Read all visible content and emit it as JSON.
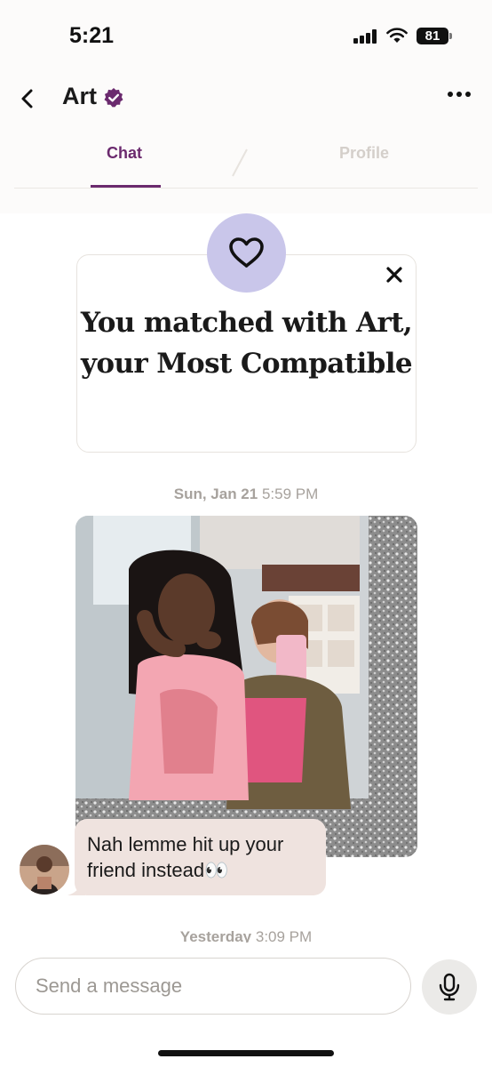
{
  "status_bar": {
    "time": "5:21",
    "battery": "81"
  },
  "header": {
    "title": "Art",
    "back_icon": "chevron-left-icon",
    "more_icon": "ellipsis-icon"
  },
  "tabs": [
    {
      "label": "Chat",
      "active": true
    },
    {
      "label": "Profile",
      "active": false
    }
  ],
  "match_card": {
    "headline": "You matched with Art, your Most Compatible",
    "icon": "heart-icon"
  },
  "messages": [
    {
      "date_day": "Sun, Jan 21",
      "date_time": "5:59 PM",
      "type": "photo",
      "text": "Nah lemme hit up your friend instead👀"
    }
  ],
  "next_date": {
    "day": "Yesterday",
    "time": "3:09 PM"
  },
  "composer": {
    "placeholder": "Send a message",
    "mic_icon": "microphone-icon"
  },
  "colors": {
    "accent": "#6b2a6e",
    "bubble": "#efe3df",
    "heart_circle": "#c9c6ea",
    "inactive_tab": "#d4cfca"
  }
}
